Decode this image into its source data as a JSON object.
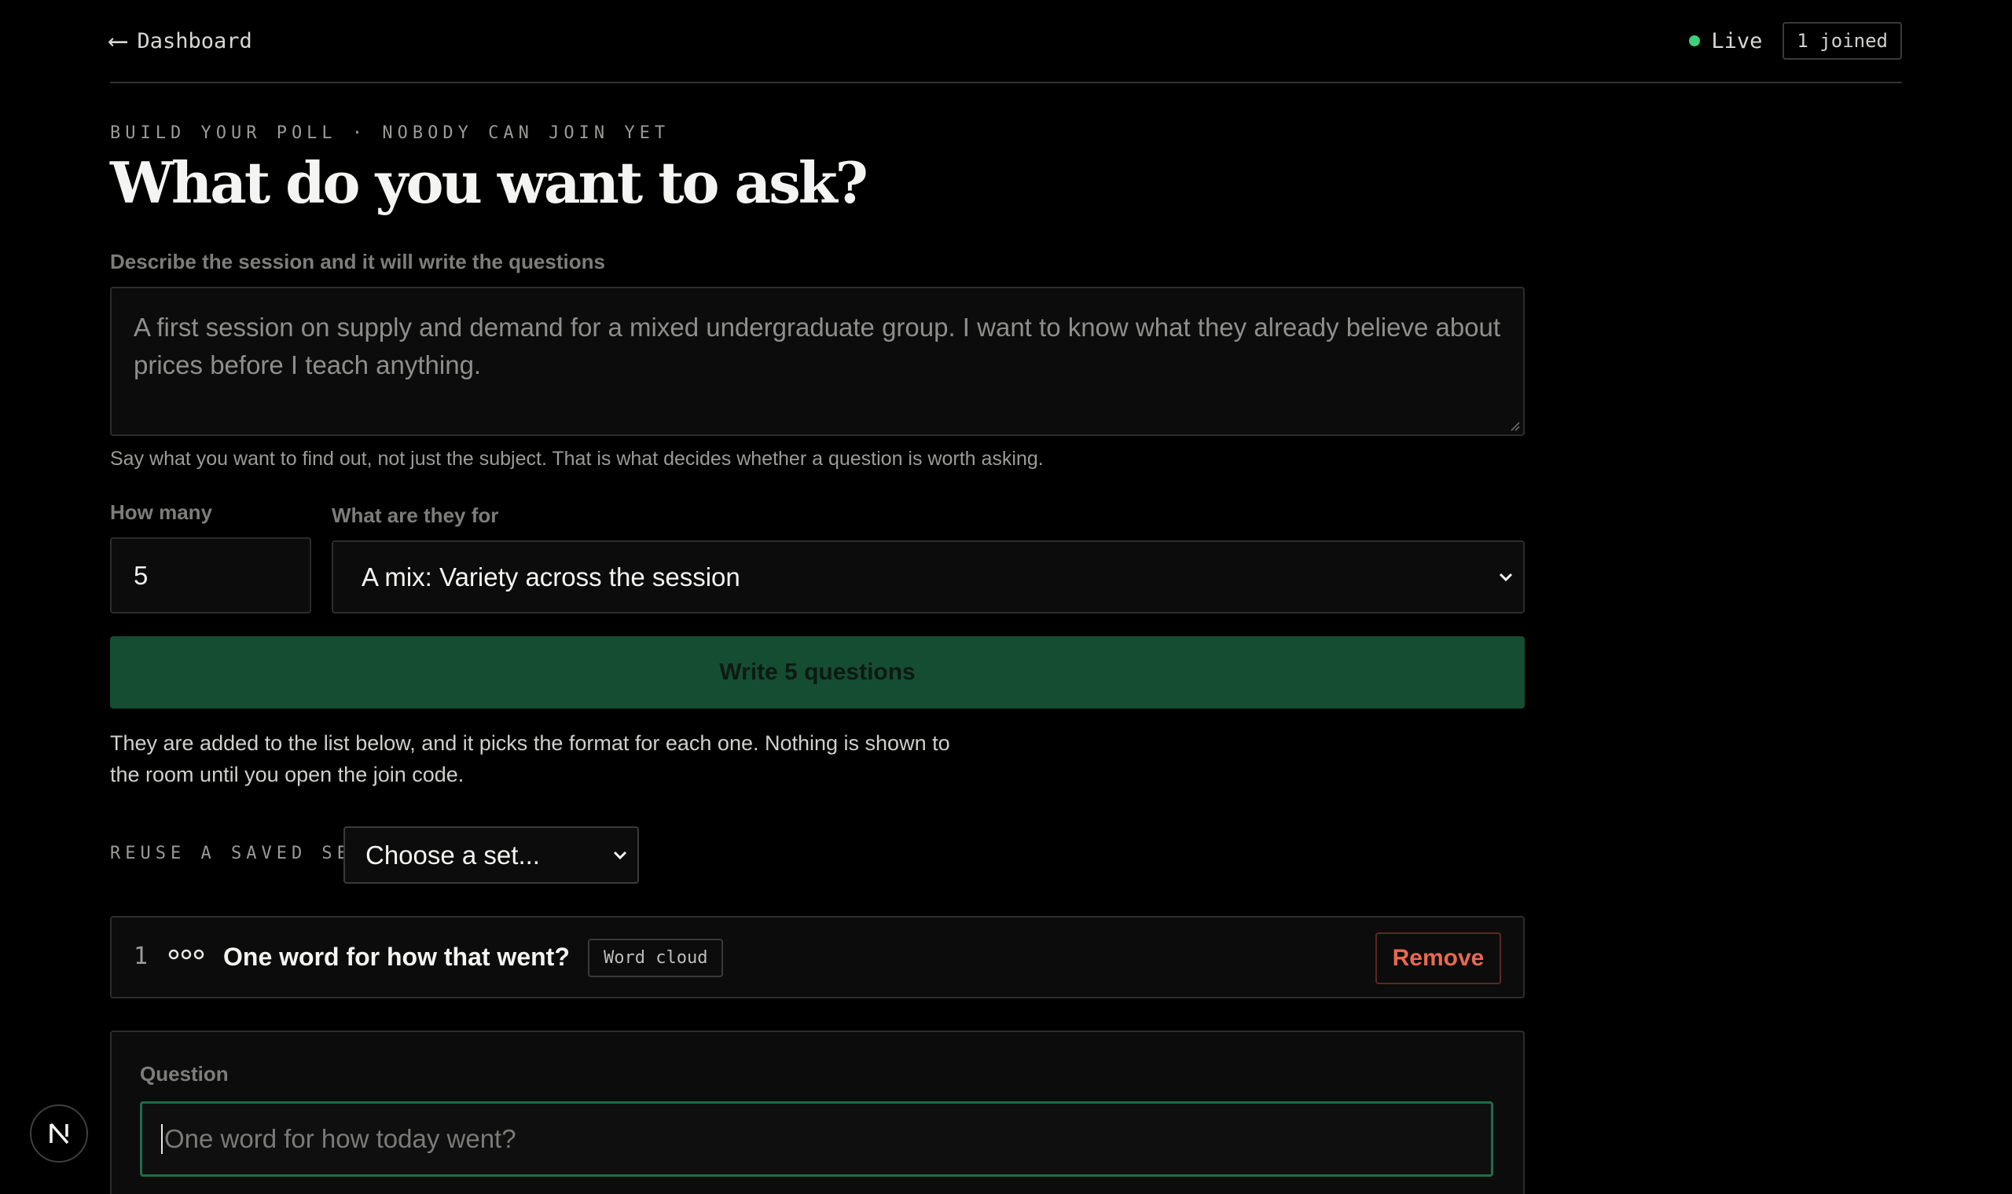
{
  "nav": {
    "back_label": "Dashboard"
  },
  "status": {
    "live_label": "Live",
    "joined_label": "1 joined",
    "live_color": "#3ecf7d"
  },
  "header": {
    "eyebrow": "BUILD YOUR POLL · NOBODY CAN JOIN YET",
    "title": "What do you want to ask?"
  },
  "describe": {
    "label": "Describe the session and it will write the questions",
    "value": "A first session on supply and demand for a mixed undergraduate group. I want to know what they already believe about prices before I teach anything.",
    "hint": "Say what you want to find out, not just the subject. That is what decides whether a question is worth asking."
  },
  "options": {
    "count_label": "How many",
    "count_value": "5",
    "purpose_label": "What are they for",
    "purpose_value": "A mix: Variety across the session"
  },
  "generate": {
    "button_label": "Write 5 questions",
    "note": "They are added to the list below, and it picks the format for each one. Nothing is shown to the room until you open the join code.",
    "accent": "#154d33"
  },
  "reuse": {
    "label": "REUSE A SAVED SET",
    "select_value": "Choose a set..."
  },
  "questions": [
    {
      "number": "1",
      "text": "One word for how that went?",
      "type": "Word cloud",
      "icon": "word-cloud-icon",
      "remove_label": "Remove"
    }
  ],
  "editor": {
    "question_label": "Question",
    "input_placeholder": "One word for how today went?"
  },
  "app_badge": {
    "letter": "N"
  }
}
